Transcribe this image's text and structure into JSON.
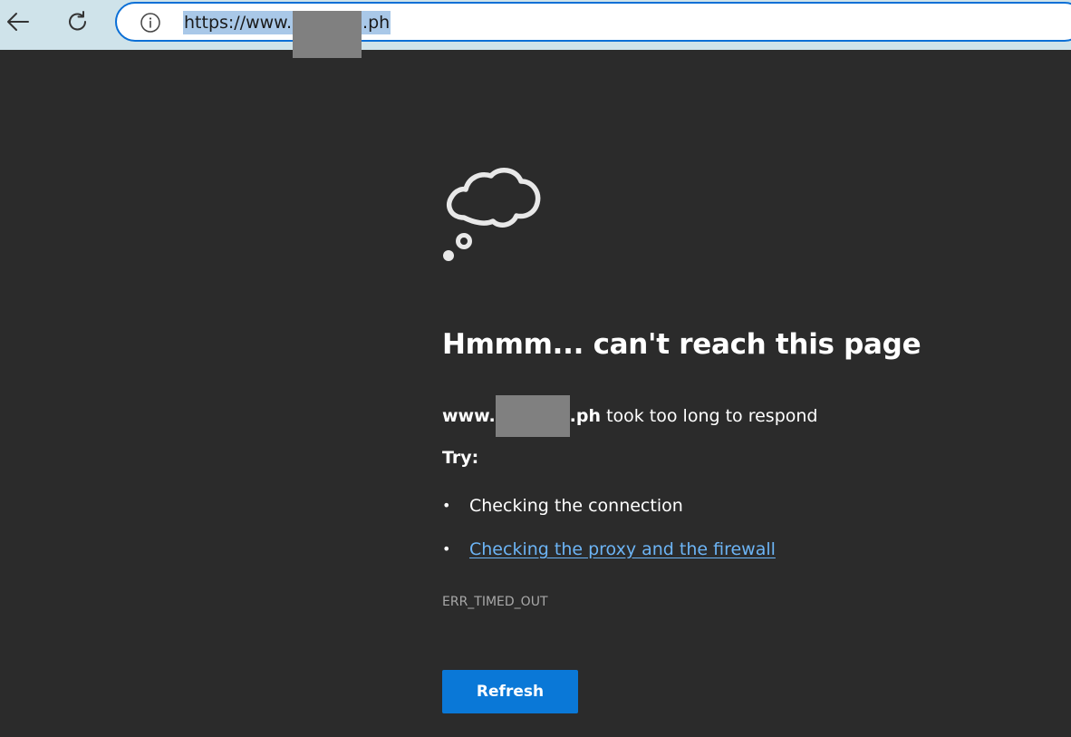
{
  "browser": {
    "back_icon": "arrow-left-icon",
    "refresh_icon": "refresh-icon",
    "info_icon": "info-icon",
    "url_prefix": "https://www.",
    "url_suffix": ".ph",
    "accent_color": "#0a6fd6",
    "toolbar_color": "#cfe3ea"
  },
  "error_page": {
    "icon": "thought-cloud-icon",
    "title": "Hmmm... can't reach this page",
    "site_prefix": "www.",
    "site_suffix": ".ph",
    "message": " took too long to respond",
    "try_label": "Try:",
    "suggestions": [
      {
        "label": "Checking the connection",
        "is_link": false
      },
      {
        "label": "Checking the proxy and the firewall",
        "is_link": true
      }
    ],
    "error_code": "ERR_TIMED_OUT",
    "refresh_label": "Refresh",
    "background_color": "#2b2b2b",
    "link_color": "#6cb4f5",
    "button_color": "#0a78d7"
  }
}
